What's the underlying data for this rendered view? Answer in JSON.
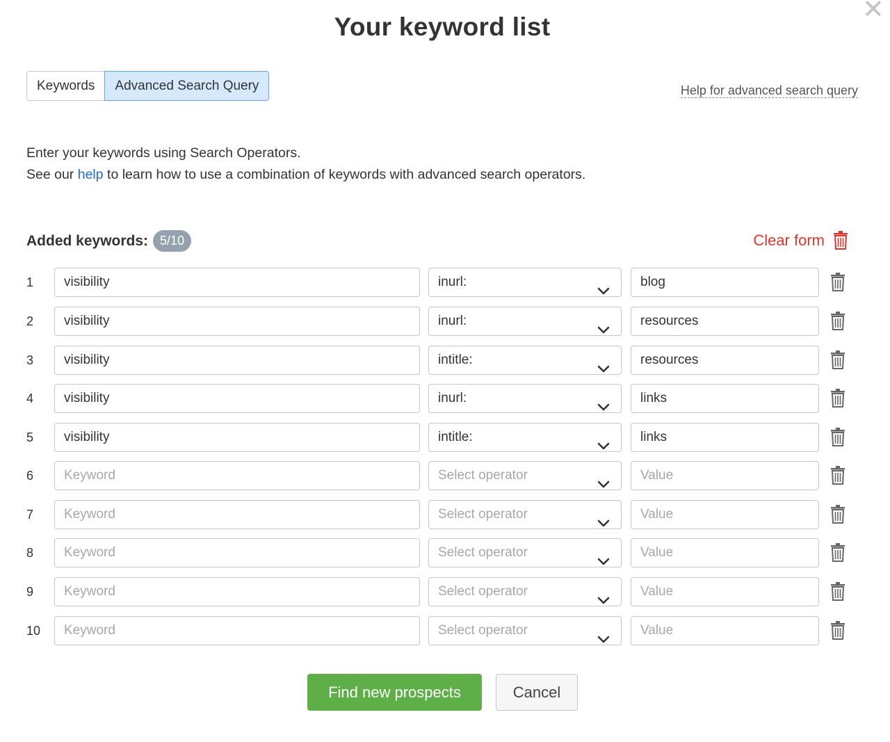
{
  "dialog": {
    "title": "Your keyword list",
    "close_glyph": "✕"
  },
  "tabs": [
    {
      "label": "Keywords",
      "active": false
    },
    {
      "label": "Advanced Search Query",
      "active": true
    }
  ],
  "help_link": "Help for advanced search query",
  "intro": {
    "line1": "Enter your keywords using Search Operators.",
    "line2_before": "See our",
    "line2_link": "help",
    "line2_after": "to learn how to use a combination of keywords with advanced search operators."
  },
  "added": {
    "label": "Added keywords:",
    "count": "5/10"
  },
  "clear_form": {
    "label": "Clear form",
    "color": "#e0342d"
  },
  "placeholders": {
    "keyword": "Keyword",
    "operator": "Select operator",
    "value": "Value"
  },
  "rows": [
    {
      "num": "1",
      "keyword": "visibility",
      "operator": "inurl:",
      "value": "blog"
    },
    {
      "num": "2",
      "keyword": "visibility",
      "operator": "inurl:",
      "value": "resources"
    },
    {
      "num": "3",
      "keyword": "visibility",
      "operator": "intitle:",
      "value": "resources"
    },
    {
      "num": "4",
      "keyword": "visibility",
      "operator": "inurl:",
      "value": "links"
    },
    {
      "num": "5",
      "keyword": "visibility",
      "operator": "intitle:",
      "value": "links"
    },
    {
      "num": "6",
      "keyword": "",
      "operator": "",
      "value": ""
    },
    {
      "num": "7",
      "keyword": "",
      "operator": "",
      "value": ""
    },
    {
      "num": "8",
      "keyword": "",
      "operator": "",
      "value": ""
    },
    {
      "num": "9",
      "keyword": "",
      "operator": "",
      "value": ""
    },
    {
      "num": "10",
      "keyword": "",
      "operator": "",
      "value": ""
    }
  ],
  "buttons": {
    "find": "Find new prospects",
    "cancel": "Cancel"
  },
  "colors": {
    "primary_button": "#5eaf47",
    "active_tab": "#d6e8fb",
    "link": "#1a6ec9",
    "danger": "#e0342d"
  }
}
